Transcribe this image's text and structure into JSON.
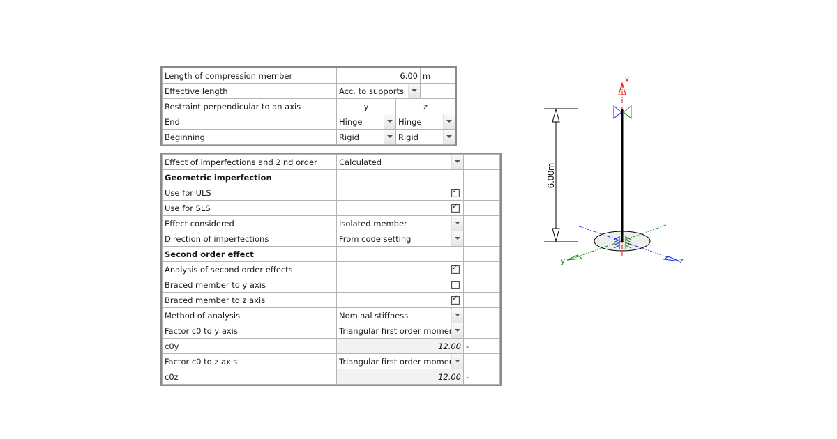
{
  "restraint_table": {
    "length": {
      "label": "Length of compression member",
      "value": "6.00",
      "unit": "m"
    },
    "effective_length": {
      "label": "Effective length",
      "value": "Acc. to supports"
    },
    "restraint": {
      "label": "Restraint perpendicular to an axis",
      "col_y": "y",
      "col_z": "z"
    },
    "end": {
      "label": "End",
      "y": "Hinge",
      "z": "Hinge"
    },
    "beginning": {
      "label": "Beginning",
      "y": "Rigid",
      "z": "Rigid"
    }
  },
  "settings_table": {
    "effect": {
      "label": "Effect of imperfections and 2'nd order",
      "value": "Calculated"
    },
    "geo_header": "Geometric imperfection",
    "uls": {
      "label": "Use for ULS",
      "checked": true
    },
    "sls": {
      "label": "Use for SLS",
      "checked": true
    },
    "effect_considered": {
      "label": "Effect considered",
      "value": "Isolated member"
    },
    "direction": {
      "label": "Direction of imperfections",
      "value": "From code setting"
    },
    "second_header": "Second order effect",
    "analysis": {
      "label": "Analysis of second order effects",
      "checked": true
    },
    "braced_y": {
      "label": "Braced member to y axis",
      "checked": false
    },
    "braced_z": {
      "label": "Braced member to z axis",
      "checked": true
    },
    "method": {
      "label": "Method of analysis",
      "value": "Nominal stiffness"
    },
    "c0y_factor": {
      "label": "Factor c0 to y axis",
      "value": "Triangular first order moment"
    },
    "c0y": {
      "label": "c0y",
      "value": "12.00",
      "unit": "-"
    },
    "c0z_factor": {
      "label": "Factor c0 to z axis",
      "value": "Triangular first order moment"
    },
    "c0z": {
      "label": "c0z",
      "value": "12.00",
      "unit": "-"
    }
  },
  "diagram": {
    "dimension_label": "6.00m",
    "axis_x": "x",
    "axis_y": "y",
    "axis_z": "z",
    "colors": {
      "x": "#e01010",
      "y": "#1a8a1a",
      "z": "#1a2ee0",
      "member": "#000000"
    }
  }
}
